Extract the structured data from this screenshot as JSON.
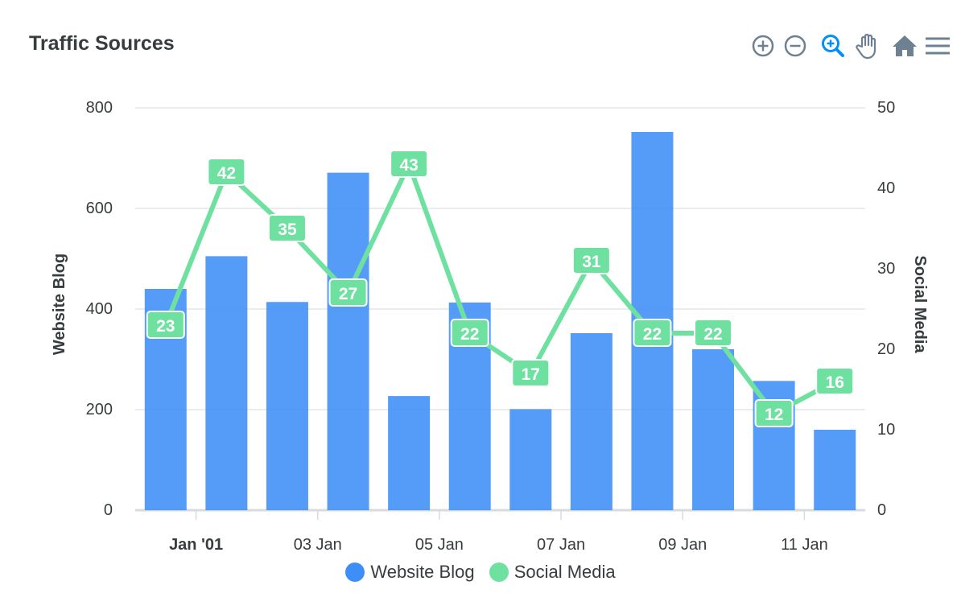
{
  "title": "Traffic Sources",
  "toolbar": {
    "icons": [
      "zoom-in-icon",
      "zoom-out-icon",
      "selection-zoom-icon",
      "pan-hand-icon",
      "reset-home-icon",
      "menu-icon"
    ],
    "colors": {
      "default": "#6e8192",
      "active": "#008ffb"
    }
  },
  "legend": {
    "items": [
      {
        "label": "Website Blog",
        "color": "#3e8ef7"
      },
      {
        "label": "Social Media",
        "color": "#6ee0a0"
      }
    ]
  },
  "chart_data": {
    "type": "bar",
    "x_tick_labels": [
      "Jan '01",
      "03 Jan",
      "05 Jan",
      "07 Jan",
      "09 Jan",
      "11 Jan"
    ],
    "y_left": {
      "label": "Website Blog",
      "ticks": [
        "0",
        "200",
        "400",
        "600",
        "800"
      ],
      "min": 0,
      "max": 800
    },
    "y_right": {
      "label": "Social Media",
      "ticks": [
        "0",
        "10",
        "20",
        "30",
        "40",
        "50"
      ],
      "min": 0,
      "max": 50
    },
    "grid": true,
    "legend_position": "bottom",
    "series": [
      {
        "name": "Website Blog",
        "type": "bar",
        "color": "#3e8ef7",
        "values": [
          440,
          505,
          414,
          671,
          227,
          413,
          201,
          352,
          752,
          320,
          257,
          160
        ]
      },
      {
        "name": "Social Media",
        "type": "line",
        "color": "#6ee0a0",
        "values": [
          23,
          42,
          35,
          27,
          43,
          22,
          17,
          31,
          22,
          22,
          12,
          16
        ]
      }
    ]
  }
}
